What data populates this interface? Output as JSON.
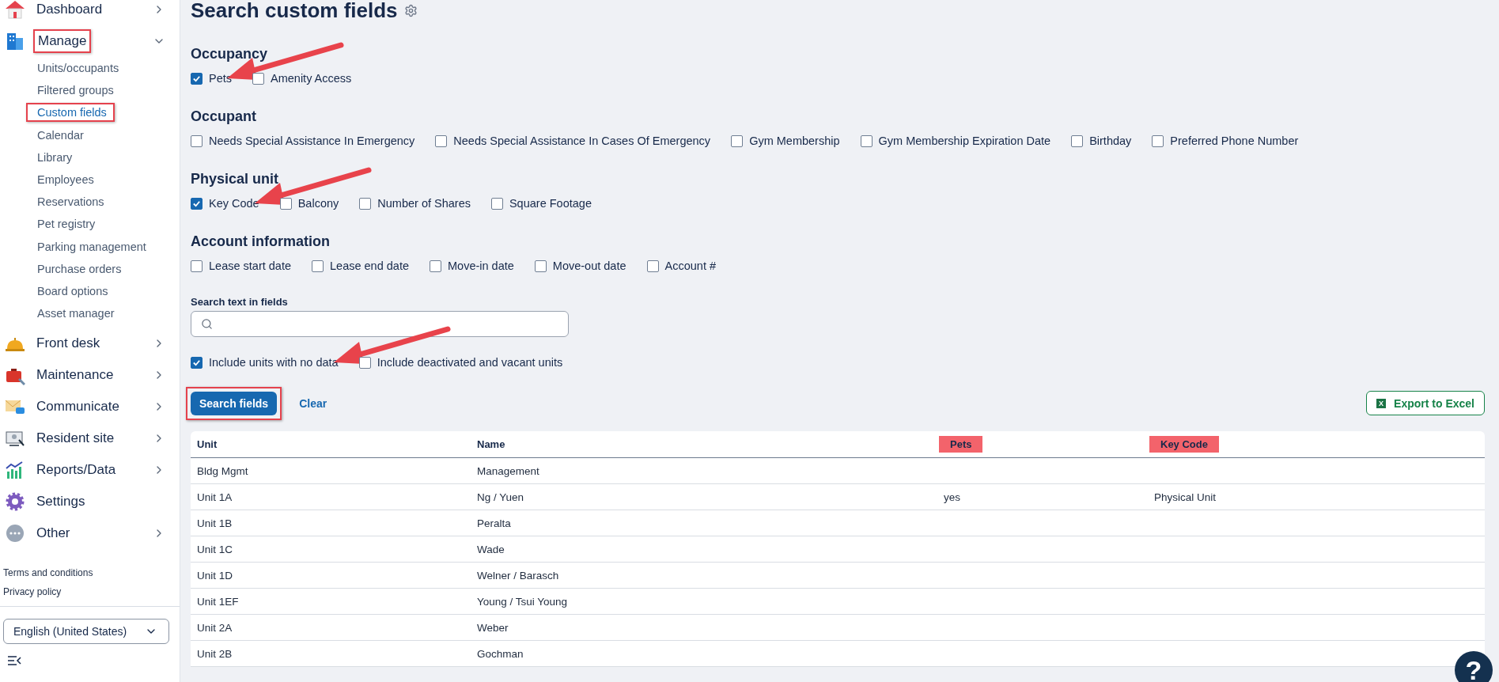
{
  "sidebar": {
    "items": [
      {
        "label": "Dashboard",
        "expanded": false,
        "annotated": false
      },
      {
        "label": "Manage",
        "expanded": true,
        "annotated": true,
        "children": [
          {
            "label": "Units/occupants",
            "selected": false,
            "annotated": false
          },
          {
            "label": "Filtered groups",
            "selected": false,
            "annotated": false
          },
          {
            "label": "Custom fields",
            "selected": true,
            "annotated": true
          },
          {
            "label": "Calendar",
            "selected": false,
            "annotated": false
          },
          {
            "label": "Library",
            "selected": false,
            "annotated": false
          },
          {
            "label": "Employees",
            "selected": false,
            "annotated": false
          },
          {
            "label": "Reservations",
            "selected": false,
            "annotated": false
          },
          {
            "label": "Pet registry",
            "selected": false,
            "annotated": false
          },
          {
            "label": "Parking management",
            "selected": false,
            "annotated": false
          },
          {
            "label": "Purchase orders",
            "selected": false,
            "annotated": false
          },
          {
            "label": "Board options",
            "selected": false,
            "annotated": false
          },
          {
            "label": "Asset manager",
            "selected": false,
            "annotated": false
          }
        ]
      },
      {
        "label": "Front desk",
        "expanded": false,
        "annotated": false
      },
      {
        "label": "Maintenance",
        "expanded": false,
        "annotated": false
      },
      {
        "label": "Communicate",
        "expanded": false,
        "annotated": false
      },
      {
        "label": "Resident site",
        "expanded": false,
        "annotated": false
      },
      {
        "label": "Reports/Data",
        "expanded": false,
        "annotated": false
      },
      {
        "label": "Settings",
        "annotated": false
      },
      {
        "label": "Other",
        "expanded": false,
        "annotated": false
      }
    ],
    "footer_links": [
      "Terms and conditions",
      "Privacy policy"
    ],
    "language": "English (United States)"
  },
  "page": {
    "title": "Search custom fields",
    "sections": [
      {
        "heading": "Occupancy",
        "fields": [
          {
            "label": "Pets",
            "checked": true,
            "arrow": true
          },
          {
            "label": "Amenity Access",
            "checked": false,
            "arrow": false
          }
        ]
      },
      {
        "heading": "Occupant",
        "fields": [
          {
            "label": "Needs Special Assistance In Emergency",
            "checked": false,
            "arrow": false
          },
          {
            "label": "Needs Special Assistance In Cases Of Emergency",
            "checked": false,
            "arrow": false
          },
          {
            "label": "Gym Membership",
            "checked": false,
            "arrow": false
          },
          {
            "label": "Gym Membership Expiration Date",
            "checked": false,
            "arrow": false
          },
          {
            "label": "Birthday",
            "checked": false,
            "arrow": false
          },
          {
            "label": "Preferred Phone Number",
            "checked": false,
            "arrow": false
          }
        ]
      },
      {
        "heading": "Physical unit",
        "fields": [
          {
            "label": "Key Code",
            "checked": true,
            "arrow": true
          },
          {
            "label": "Balcony",
            "checked": false,
            "arrow": false
          },
          {
            "label": "Number of Shares",
            "checked": false,
            "arrow": false
          },
          {
            "label": "Square Footage",
            "checked": false,
            "arrow": false
          }
        ]
      },
      {
        "heading": "Account information",
        "fields": [
          {
            "label": "Lease start date",
            "checked": false,
            "arrow": false
          },
          {
            "label": "Lease end date",
            "checked": false,
            "arrow": false
          },
          {
            "label": "Move-in date",
            "checked": false,
            "arrow": false
          },
          {
            "label": "Move-out date",
            "checked": false,
            "arrow": false
          },
          {
            "label": "Account #",
            "checked": false,
            "arrow": false
          }
        ]
      }
    ],
    "search": {
      "label": "Search text in fields"
    },
    "options": [
      {
        "label": "Include units with no data",
        "checked": true,
        "arrow": true
      },
      {
        "label": "Include deactivated and vacant units",
        "checked": false,
        "arrow": false
      }
    ],
    "buttons": {
      "search": {
        "label": "Search fields",
        "annotated": true
      },
      "clear": "Clear",
      "export": {
        "label": "Export to Excel",
        "icon_text": "X"
      }
    }
  },
  "table": {
    "columns": [
      {
        "label": "Unit",
        "highlighted": false
      },
      {
        "label": "Name",
        "highlighted": false
      },
      {
        "label": "Pets",
        "highlighted": true
      },
      {
        "label": "Key Code",
        "highlighted": true
      }
    ],
    "rows": [
      [
        "Bldg Mgmt",
        "Management",
        "",
        ""
      ],
      [
        "Unit 1A",
        "Ng / Yuen",
        "yes",
        "Physical Unit"
      ],
      [
        "Unit 1B",
        "Peralta",
        "",
        ""
      ],
      [
        "Unit 1C",
        "Wade",
        "",
        ""
      ],
      [
        "Unit 1D",
        "Welner / Barasch",
        "",
        ""
      ],
      [
        "Unit 1EF",
        "Young / Tsui Young",
        "",
        ""
      ],
      [
        "Unit 2A",
        "Weber",
        "",
        ""
      ],
      [
        "Unit 2B",
        "Gochman",
        "",
        ""
      ]
    ]
  },
  "help": "?"
}
